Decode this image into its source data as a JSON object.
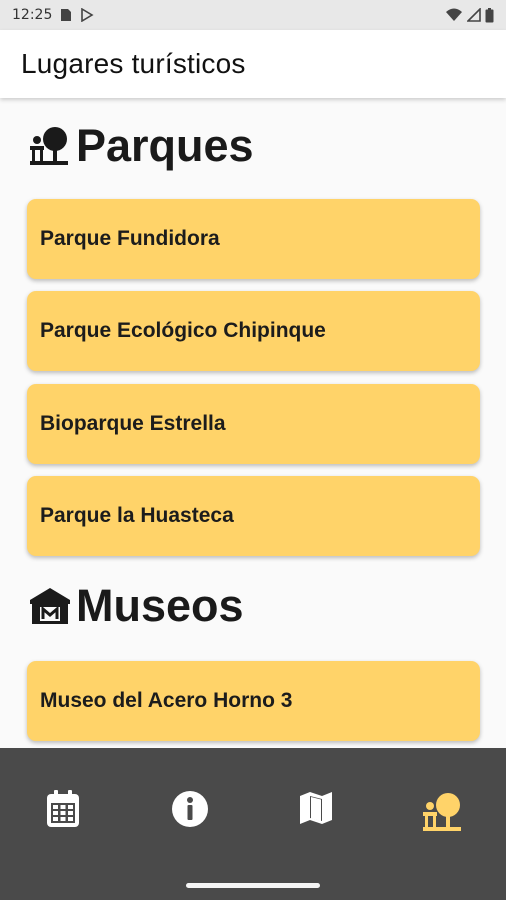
{
  "status_bar": {
    "time": "12:25"
  },
  "app_bar": {
    "title": "Lugares turísticos"
  },
  "sections": [
    {
      "title": "Parques",
      "icon": "park-icon",
      "items": [
        "Parque Fundidora",
        "Parque Ecológico Chipinque",
        "Bioparque Estrella",
        "Parque la Huasteca"
      ]
    },
    {
      "title": "Museos",
      "icon": "museum-icon",
      "items": [
        "Museo del Acero Horno 3"
      ]
    }
  ],
  "bottom_nav": {
    "items": [
      {
        "icon": "calendar-icon",
        "active": false
      },
      {
        "icon": "info-icon",
        "active": false
      },
      {
        "icon": "map-icon",
        "active": false
      },
      {
        "icon": "park-icon",
        "active": true
      }
    ],
    "active_color": "#ffd369",
    "inactive_color": "#ffffff"
  },
  "colors": {
    "card": "#ffd369",
    "nav_background": "#4a4a4a",
    "status_bar": "#e8e8e8"
  }
}
